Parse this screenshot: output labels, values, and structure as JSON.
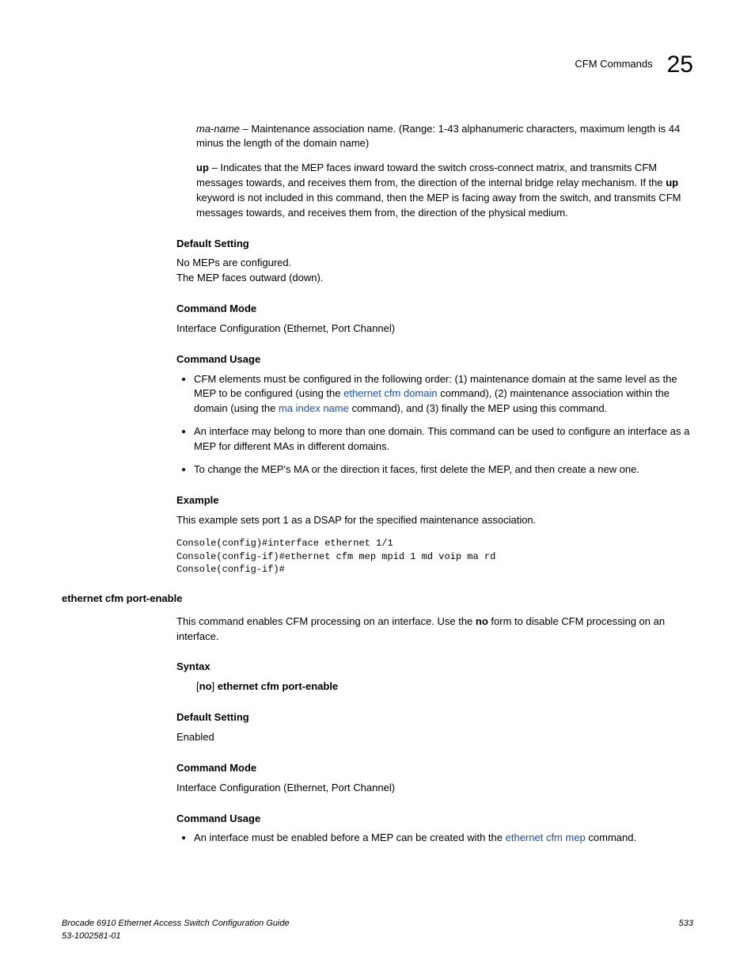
{
  "header": {
    "title": "CFM Commands",
    "chapter": "25"
  },
  "sec1": {
    "maNameLabel": "ma-name",
    "maNameText": " – Maintenance association name. (Range: 1-43 alphanumeric characters, maximum length is 44 minus the length of the domain name)",
    "upLabel": "up",
    "upText1": " – Indicates that the MEP faces inward toward the switch cross-connect matrix, and transmits CFM messages towards, and receives them from, the direction of the internal bridge relay mechanism. If the ",
    "upBold2": "up",
    "upText2": " keyword is not included in this command, then the MEP is facing away from the switch, and transmits CFM messages towards, and receives them from, the direction of the physical medium.",
    "defaultHead": "Default Setting",
    "defaultLine1": "No MEPs are configured.",
    "defaultLine2": "The MEP faces outward (down).",
    "modeHead": "Command Mode",
    "modeText": "Interface Configuration (Ethernet, Port Channel)",
    "usageHead": "Command Usage",
    "usage1a": "CFM elements must be configured in the following order: (1) maintenance domain at the same level as the MEP to be configured (using the ",
    "usage1link1": "ethernet cfm domain",
    "usage1b": " command), (2) maintenance association within the domain (using the ",
    "usage1link2": "ma index name",
    "usage1c": " command), and (3) finally the MEP using this command.",
    "usage2": "An interface may belong to more than one domain. This command can be used to configure an interface as a MEP for different MAs in different domains.",
    "usage3": "To change the MEP's MA or the direction it faces, first delete the MEP, and then create a new one.",
    "exampleHead": "Example",
    "exampleText": "This example sets port 1 as a DSAP for the specified maintenance association.",
    "code": "Console(config)#interface ethernet 1/1\nConsole(config-if)#ethernet cfm mep mpid 1 md voip ma rd\nConsole(config-if)#"
  },
  "sec2": {
    "cmdName": "ethernet cfm port-enable",
    "desc1": "This command enables CFM processing on an interface. Use the ",
    "descBold": "no",
    "desc2": " form to disable CFM processing on an interface.",
    "syntaxHead": "Syntax",
    "syntaxPre": "[",
    "syntaxNo": "no",
    "syntaxMid": "] ",
    "syntaxCmd": "ethernet cfm port-enable",
    "defaultHead": "Default Setting",
    "defaultText": "Enabled",
    "modeHead": "Command Mode",
    "modeText": "Interface Configuration (Ethernet, Port Channel)",
    "usageHead": "Command Usage",
    "usage1a": "An interface must be enabled before a MEP can be created with the ",
    "usage1link": "ethernet cfm mep",
    "usage1b": " command."
  },
  "footer": {
    "line1": "Brocade 6910 Ethernet Access Switch Configuration Guide",
    "line2": "53-1002581-01",
    "page": "533"
  }
}
